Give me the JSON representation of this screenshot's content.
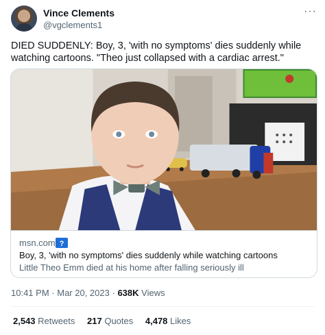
{
  "author": {
    "name": "Vince Clements",
    "handle": "@vgclements1"
  },
  "more_icon": "more-horizontal-icon",
  "tweet": {
    "text": "DIED SUDDENLY: Boy, 3, 'with no symptoms' dies suddenly while watching cartoons. \"Theo just collapsed with a cardiac arrest.\""
  },
  "card": {
    "domain": "msn.com",
    "badge_icon": "shield-question-icon",
    "badge_text": "?",
    "title": "Boy, 3, 'with no symptoms' dies suddenly while watching cartoons",
    "description": "Little Theo Emm died at his home after falling seriously ill"
  },
  "meta": {
    "time": "10:41 PM",
    "separator": "·",
    "date": "Mar 20, 2023",
    "views_count": "638K",
    "views_label": "Views"
  },
  "stats": {
    "retweets_count": "2,543",
    "retweets_label": "Retweets",
    "quotes_count": "217",
    "quotes_label": "Quotes",
    "likes_count": "4,478",
    "likes_label": "Likes"
  },
  "colors": {
    "text": "#0f1419",
    "secondary": "#536471",
    "border": "#cfd9de",
    "badge": "#1d6fd8"
  }
}
